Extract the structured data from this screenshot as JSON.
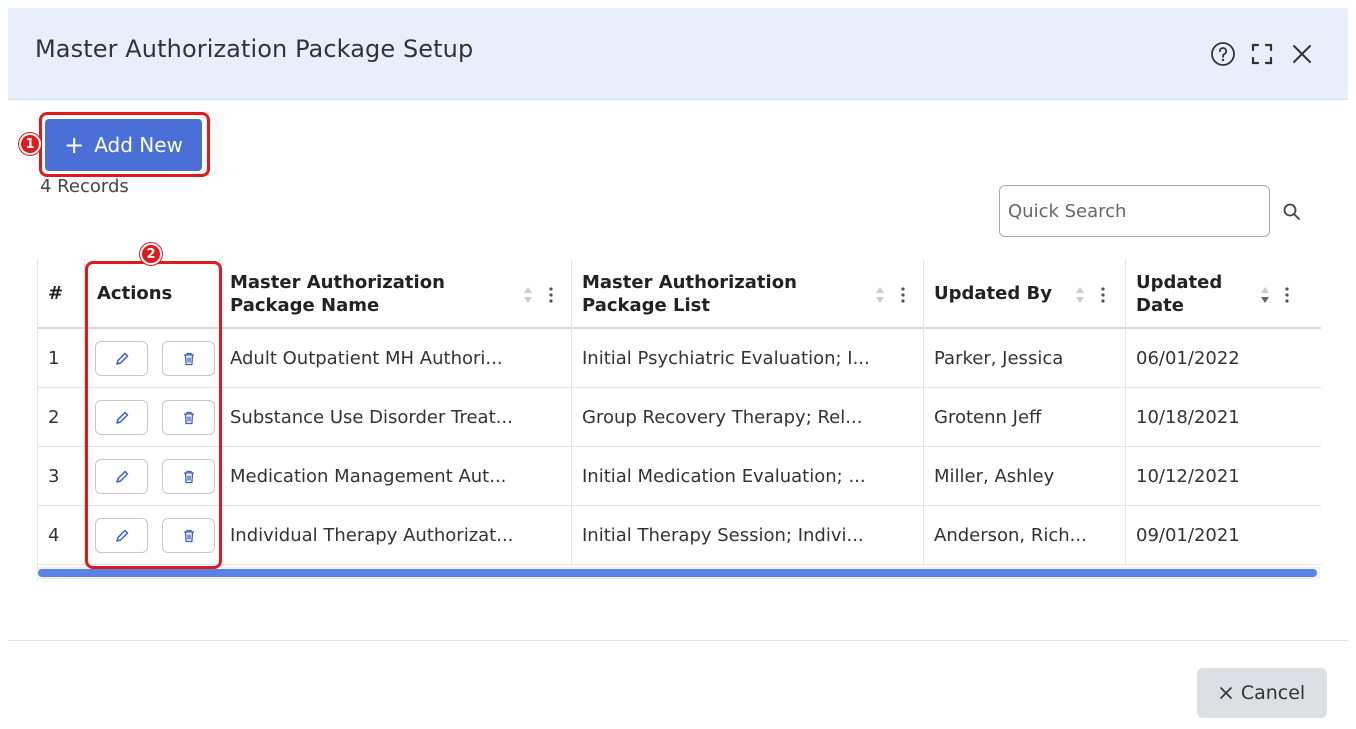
{
  "modal": {
    "title": "Master Authorization Package Setup"
  },
  "toolbar": {
    "add_new_label": "Add New",
    "records_label": "4 Records",
    "search_placeholder": "Quick Search"
  },
  "annotations": {
    "badge_1": "1",
    "badge_2": "2"
  },
  "table": {
    "columns": [
      {
        "key": "index",
        "label": "#"
      },
      {
        "key": "actions",
        "label": "Actions"
      },
      {
        "key": "name",
        "label": "Master Authorization Package Name"
      },
      {
        "key": "list",
        "label": "Master Authorization Package List"
      },
      {
        "key": "updated_by",
        "label": "Updated By"
      },
      {
        "key": "updated_date",
        "label": "Updated Date"
      }
    ],
    "rows": [
      {
        "index": "1",
        "name": "Adult Outpatient MH Authori...",
        "list": "Initial Psychiatric Evaluation; I...",
        "updated_by": "Parker, Jessica",
        "updated_date": "06/01/2022"
      },
      {
        "index": "2",
        "name": "Substance Use Disorder Treat...",
        "list": "Group Recovery Therapy; Rel...",
        "updated_by": "Grotenn Jeff",
        "updated_date": "10/18/2021"
      },
      {
        "index": "3",
        "name": "Medication Management Aut...",
        "list": "Initial Medication Evaluation; ...",
        "updated_by": "Miller, Ashley",
        "updated_date": "10/12/2021"
      },
      {
        "index": "4",
        "name": "Individual Therapy Authorizat...",
        "list": "Initial Therapy Session; Indivi...",
        "updated_by": "Anderson, Rich...",
        "updated_date": "09/01/2021"
      }
    ]
  },
  "footer": {
    "cancel_label": "Cancel"
  },
  "colors": {
    "accent": "#4a6fd6",
    "highlight": "#e0191c",
    "header_bg": "#e8effb",
    "icon_blue": "#3b5fc9"
  },
  "icons": {
    "help": "help-circle-icon",
    "expand": "expand-icon",
    "close": "close-icon",
    "search": "search-icon",
    "edit": "pencil-icon",
    "delete": "trash-icon"
  }
}
